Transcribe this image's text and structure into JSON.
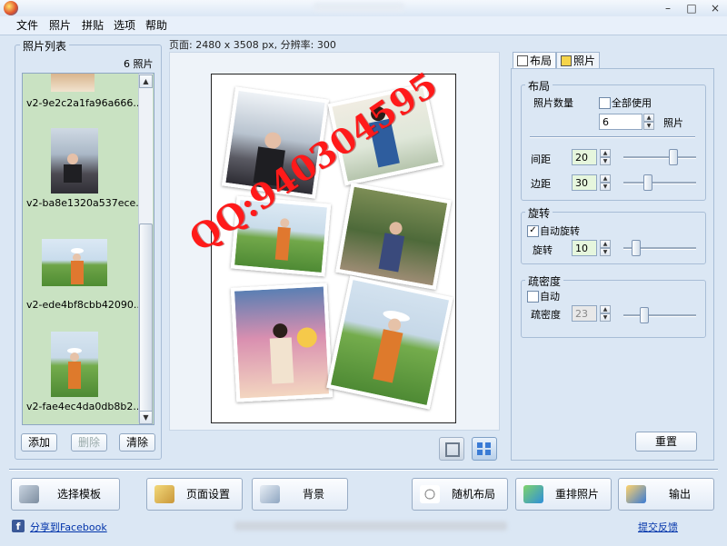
{
  "menu": [
    "文件",
    "照片",
    "拼贴",
    "选项",
    "帮助"
  ],
  "window_buttons": [
    "–",
    "□",
    "×"
  ],
  "photo_list": {
    "title": "照片列表",
    "count": "6 照片",
    "items": [
      {
        "label": "v2-9e2c2a1fa96a666..."
      },
      {
        "label": "v2-ba8e1320a537ece..."
      },
      {
        "label": "v2-ede4bf8cbb42090..."
      },
      {
        "label": "v2-fae4ec4da0db8b2..."
      }
    ],
    "buttons": {
      "add": "添加",
      "delete": "删除",
      "clear": "清除"
    }
  },
  "page_info": "页面: 2480 x 3508 px, 分辨率: 300",
  "tabs": {
    "layout": "布局",
    "photos": "照片"
  },
  "layout_group": {
    "title": "布局",
    "photo_count_label": "照片数量",
    "use_all_label": "全部使用",
    "photo_count_value": "6",
    "photo_unit": "照片",
    "spacing_label": "间距",
    "spacing_value": "20",
    "margin_label": "边距",
    "margin_value": "30"
  },
  "rotation_group": {
    "title": "旋转",
    "auto_label": "自动旋转",
    "auto_checked": "✓",
    "rotation_label": "旋转",
    "rotation_value": "10"
  },
  "density_group": {
    "title": "疏密度",
    "auto_label": "自动",
    "density_label": "疏密度",
    "density_value": "23"
  },
  "reset_button": "重置",
  "bottom_buttons": {
    "template": "选择模板",
    "page_setup": "页面设置",
    "background": "背景",
    "random_layout": "随机布局",
    "shuffle": "重排照片",
    "output": "输出"
  },
  "share_link": "分享到Facebook",
  "feedback_link": "提交反馈",
  "watermark": "QQ:940304595",
  "colors": {
    "accent": "#3a7bd5",
    "list_bg": "#c9e2c2",
    "watermark": "#ff1a1a"
  }
}
